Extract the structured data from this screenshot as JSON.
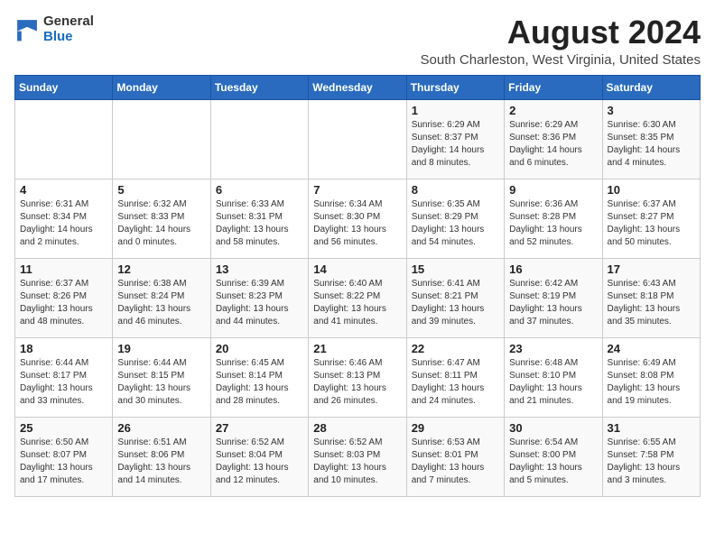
{
  "logo": {
    "line1": "General",
    "line2": "Blue"
  },
  "title": "August 2024",
  "location": "South Charleston, West Virginia, United States",
  "days_of_week": [
    "Sunday",
    "Monday",
    "Tuesday",
    "Wednesday",
    "Thursday",
    "Friday",
    "Saturday"
  ],
  "weeks": [
    [
      {
        "day": "",
        "info": ""
      },
      {
        "day": "",
        "info": ""
      },
      {
        "day": "",
        "info": ""
      },
      {
        "day": "",
        "info": ""
      },
      {
        "day": "1",
        "info": "Sunrise: 6:29 AM\nSunset: 8:37 PM\nDaylight: 14 hours\nand 8 minutes."
      },
      {
        "day": "2",
        "info": "Sunrise: 6:29 AM\nSunset: 8:36 PM\nDaylight: 14 hours\nand 6 minutes."
      },
      {
        "day": "3",
        "info": "Sunrise: 6:30 AM\nSunset: 8:35 PM\nDaylight: 14 hours\nand 4 minutes."
      }
    ],
    [
      {
        "day": "4",
        "info": "Sunrise: 6:31 AM\nSunset: 8:34 PM\nDaylight: 14 hours\nand 2 minutes."
      },
      {
        "day": "5",
        "info": "Sunrise: 6:32 AM\nSunset: 8:33 PM\nDaylight: 14 hours\nand 0 minutes."
      },
      {
        "day": "6",
        "info": "Sunrise: 6:33 AM\nSunset: 8:31 PM\nDaylight: 13 hours\nand 58 minutes."
      },
      {
        "day": "7",
        "info": "Sunrise: 6:34 AM\nSunset: 8:30 PM\nDaylight: 13 hours\nand 56 minutes."
      },
      {
        "day": "8",
        "info": "Sunrise: 6:35 AM\nSunset: 8:29 PM\nDaylight: 13 hours\nand 54 minutes."
      },
      {
        "day": "9",
        "info": "Sunrise: 6:36 AM\nSunset: 8:28 PM\nDaylight: 13 hours\nand 52 minutes."
      },
      {
        "day": "10",
        "info": "Sunrise: 6:37 AM\nSunset: 8:27 PM\nDaylight: 13 hours\nand 50 minutes."
      }
    ],
    [
      {
        "day": "11",
        "info": "Sunrise: 6:37 AM\nSunset: 8:26 PM\nDaylight: 13 hours\nand 48 minutes."
      },
      {
        "day": "12",
        "info": "Sunrise: 6:38 AM\nSunset: 8:24 PM\nDaylight: 13 hours\nand 46 minutes."
      },
      {
        "day": "13",
        "info": "Sunrise: 6:39 AM\nSunset: 8:23 PM\nDaylight: 13 hours\nand 44 minutes."
      },
      {
        "day": "14",
        "info": "Sunrise: 6:40 AM\nSunset: 8:22 PM\nDaylight: 13 hours\nand 41 minutes."
      },
      {
        "day": "15",
        "info": "Sunrise: 6:41 AM\nSunset: 8:21 PM\nDaylight: 13 hours\nand 39 minutes."
      },
      {
        "day": "16",
        "info": "Sunrise: 6:42 AM\nSunset: 8:19 PM\nDaylight: 13 hours\nand 37 minutes."
      },
      {
        "day": "17",
        "info": "Sunrise: 6:43 AM\nSunset: 8:18 PM\nDaylight: 13 hours\nand 35 minutes."
      }
    ],
    [
      {
        "day": "18",
        "info": "Sunrise: 6:44 AM\nSunset: 8:17 PM\nDaylight: 13 hours\nand 33 minutes."
      },
      {
        "day": "19",
        "info": "Sunrise: 6:44 AM\nSunset: 8:15 PM\nDaylight: 13 hours\nand 30 minutes."
      },
      {
        "day": "20",
        "info": "Sunrise: 6:45 AM\nSunset: 8:14 PM\nDaylight: 13 hours\nand 28 minutes."
      },
      {
        "day": "21",
        "info": "Sunrise: 6:46 AM\nSunset: 8:13 PM\nDaylight: 13 hours\nand 26 minutes."
      },
      {
        "day": "22",
        "info": "Sunrise: 6:47 AM\nSunset: 8:11 PM\nDaylight: 13 hours\nand 24 minutes."
      },
      {
        "day": "23",
        "info": "Sunrise: 6:48 AM\nSunset: 8:10 PM\nDaylight: 13 hours\nand 21 minutes."
      },
      {
        "day": "24",
        "info": "Sunrise: 6:49 AM\nSunset: 8:08 PM\nDaylight: 13 hours\nand 19 minutes."
      }
    ],
    [
      {
        "day": "25",
        "info": "Sunrise: 6:50 AM\nSunset: 8:07 PM\nDaylight: 13 hours\nand 17 minutes."
      },
      {
        "day": "26",
        "info": "Sunrise: 6:51 AM\nSunset: 8:06 PM\nDaylight: 13 hours\nand 14 minutes."
      },
      {
        "day": "27",
        "info": "Sunrise: 6:52 AM\nSunset: 8:04 PM\nDaylight: 13 hours\nand 12 minutes."
      },
      {
        "day": "28",
        "info": "Sunrise: 6:52 AM\nSunset: 8:03 PM\nDaylight: 13 hours\nand 10 minutes."
      },
      {
        "day": "29",
        "info": "Sunrise: 6:53 AM\nSunset: 8:01 PM\nDaylight: 13 hours\nand 7 minutes."
      },
      {
        "day": "30",
        "info": "Sunrise: 6:54 AM\nSunset: 8:00 PM\nDaylight: 13 hours\nand 5 minutes."
      },
      {
        "day": "31",
        "info": "Sunrise: 6:55 AM\nSunset: 7:58 PM\nDaylight: 13 hours\nand 3 minutes."
      }
    ]
  ]
}
